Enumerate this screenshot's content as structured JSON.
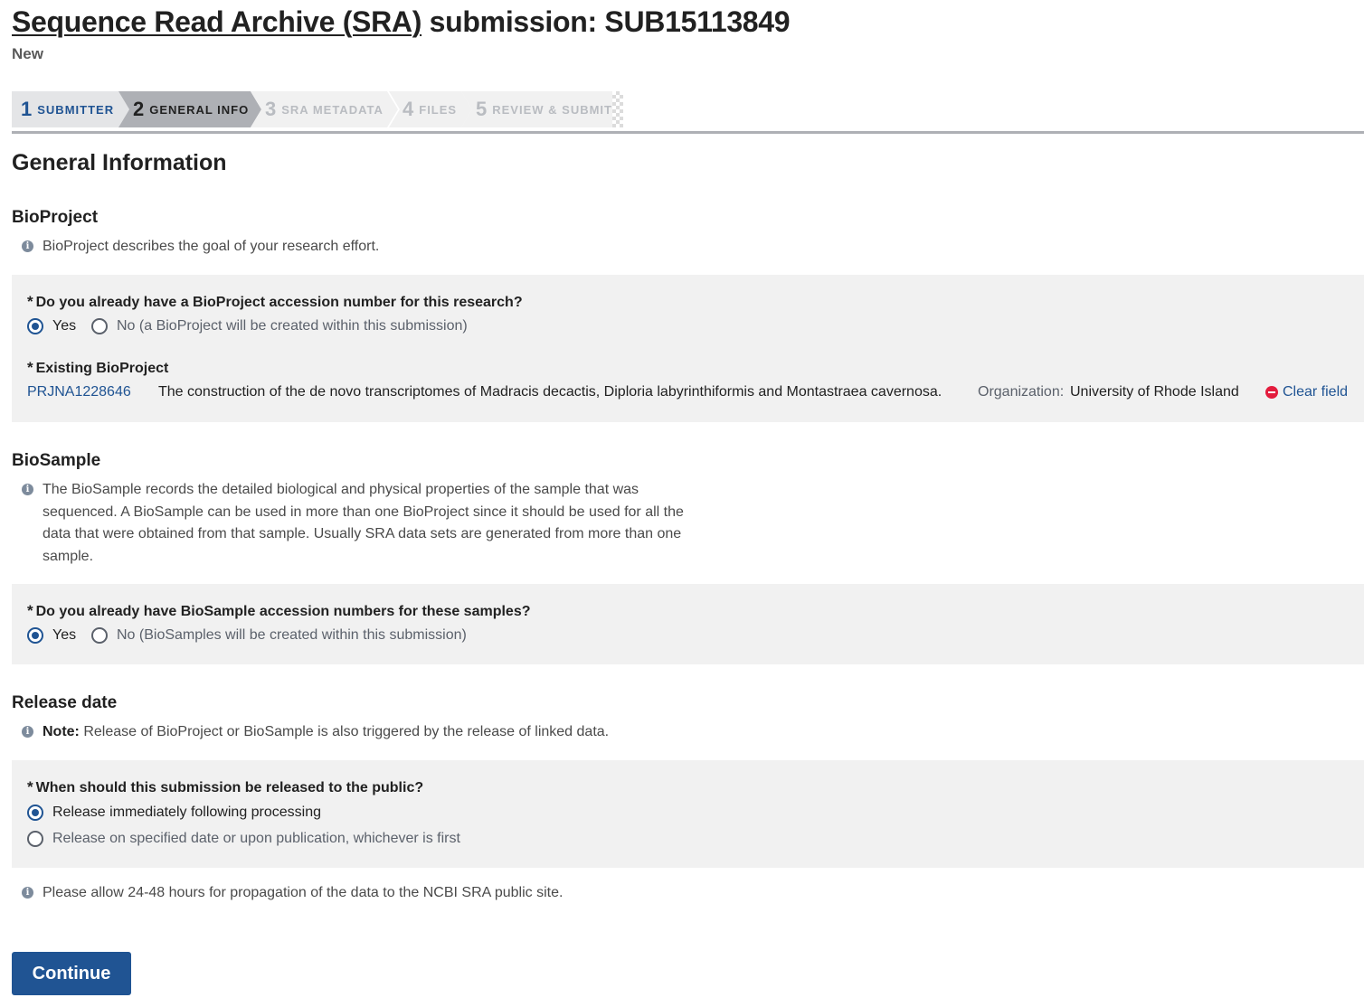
{
  "header": {
    "title_link": "Sequence Read Archive (SRA)",
    "title_rest": " submission: SUB15113849",
    "status": "New"
  },
  "wizard": {
    "steps": [
      {
        "num": "1",
        "label": "Submitter",
        "state": "done"
      },
      {
        "num": "2",
        "label": "General Info",
        "state": "current"
      },
      {
        "num": "3",
        "label": "SRA Metadata",
        "state": "future"
      },
      {
        "num": "4",
        "label": "Files",
        "state": "future"
      },
      {
        "num": "5",
        "label": "Review & Submit",
        "state": "future"
      }
    ]
  },
  "main": {
    "heading": "General Information",
    "bioproject": {
      "heading": "BioProject",
      "info": "BioProject describes the goal of your research effort.",
      "question": "Do you already have a BioProject accession number for this research?",
      "options": [
        "Yes",
        "No (a BioProject will be created within this submission)"
      ],
      "selected": "Yes",
      "existing_label": "Existing BioProject",
      "accession": "PRJNA1228646",
      "description": "The construction of the de novo transcriptomes of Madracis decactis, Diploria labyrinthiformis and Montastraea cavernosa.",
      "org_label": "Organization:",
      "organization": "University of Rhode Island",
      "clear_label": "Clear field"
    },
    "biosample": {
      "heading": "BioSample",
      "info": "The BioSample records the detailed biological and physical properties of the sample that was sequenced. A BioSample can be used in more than one BioProject since it should be used for all the data that were obtained from that sample. Usually SRA data sets are generated from more than one sample.",
      "question": "Do you already have BioSample accession numbers for these samples?",
      "options": [
        "Yes",
        "No (BioSamples will be created within this submission)"
      ],
      "selected": "Yes"
    },
    "release": {
      "heading": "Release date",
      "note_label": "Note:",
      "note": " Release of BioProject or BioSample is also triggered by the release of linked data.",
      "question": "When should this submission be released to the public?",
      "options": [
        "Release immediately following processing",
        "Release on specified date or upon publication, whichever is first"
      ],
      "selected": "Release immediately following processing",
      "propagation_info": "Please allow 24-48 hours for propagation of the data to the NCBI SRA public site."
    },
    "continue_label": "Continue"
  },
  "colors": {
    "primary": "#205493",
    "panel_bg": "#f1f1f1",
    "step_done": "#205493",
    "step_current_bg": "#aeb0b5",
    "step_done_bg": "#e4e5e7",
    "step_future_bg": "#f1f1f1",
    "clear_icon": "#e31c3d"
  },
  "icons": [
    "info-icon",
    "minus-circle-icon",
    "required-star-icon"
  ]
}
